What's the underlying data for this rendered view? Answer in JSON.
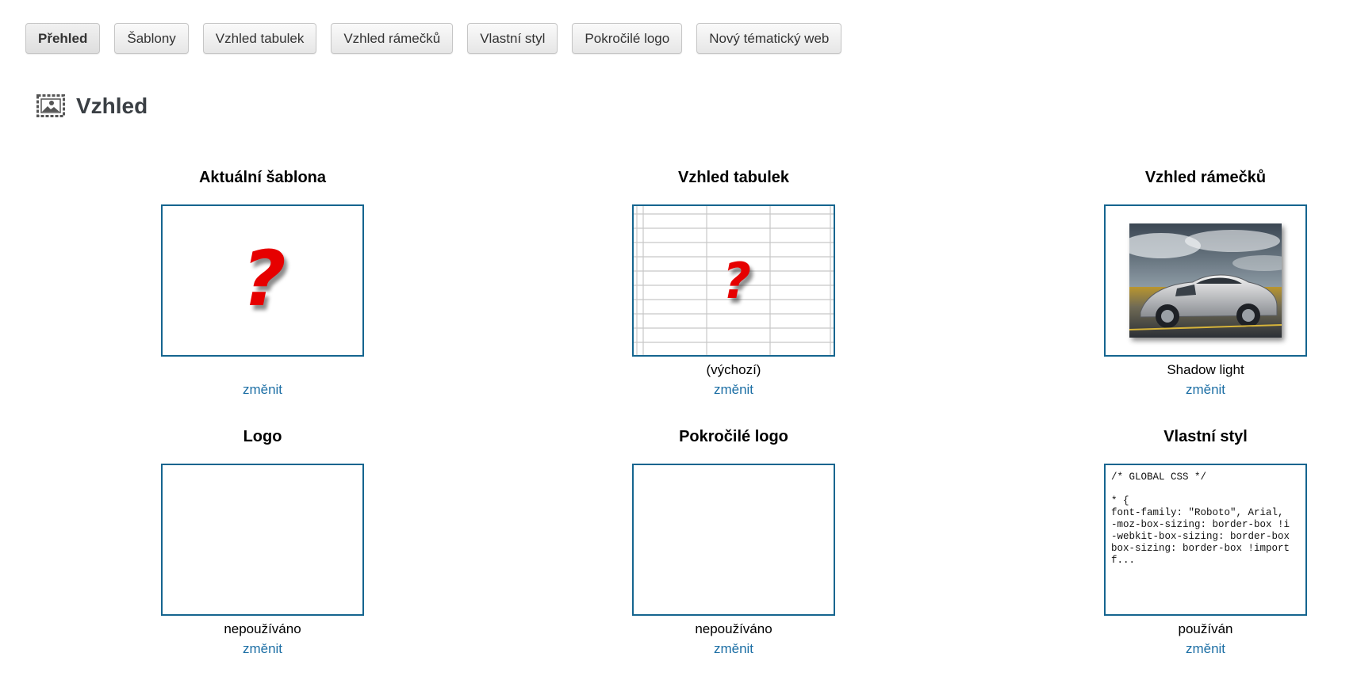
{
  "tabs": [
    {
      "label": "Přehled",
      "active": true
    },
    {
      "label": "Šablony",
      "active": false
    },
    {
      "label": "Vzhled tabulek",
      "active": false
    },
    {
      "label": "Vzhled rámečků",
      "active": false
    },
    {
      "label": "Vlastní styl",
      "active": false
    },
    {
      "label": "Pokročilé logo",
      "active": false
    },
    {
      "label": "Nový tématický web",
      "active": false
    }
  ],
  "heading": {
    "icon": "picture-frame-icon",
    "title": "Vzhled"
  },
  "cards": {
    "template": {
      "title": "Aktuální šablona",
      "status": "",
      "link": "změnit",
      "preview_icon": "question-mark-icon"
    },
    "tables": {
      "title": "Vzhled tabulek",
      "status": "(výchozí)",
      "link": "změnit",
      "preview_icon": "table-grid-question-icon"
    },
    "frames": {
      "title": "Vzhled rámečků",
      "status": "Shadow light",
      "link": "změnit",
      "preview_icon": "car-photo-thumbnail"
    },
    "logo": {
      "title": "Logo",
      "status": "nepoužíváno",
      "link": "změnit"
    },
    "advanced_logo": {
      "title": "Pokročilé logo",
      "status": "nepoužíváno",
      "link": "změnit"
    },
    "custom_style": {
      "title": "Vlastní styl",
      "status": "používán",
      "link": "změnit",
      "code": "/* GLOBAL CSS */\n\n* {\nfont-family: \"Roboto\", Arial,\n-moz-box-sizing: border-box !i\n-webkit-box-sizing: border-box\nbox-sizing: border-box !import\nf..."
    }
  },
  "colors": {
    "frame_border": "#15658f",
    "link": "#1d6fa5",
    "question_mark": "#e60000",
    "heading": "#3a3f44"
  }
}
